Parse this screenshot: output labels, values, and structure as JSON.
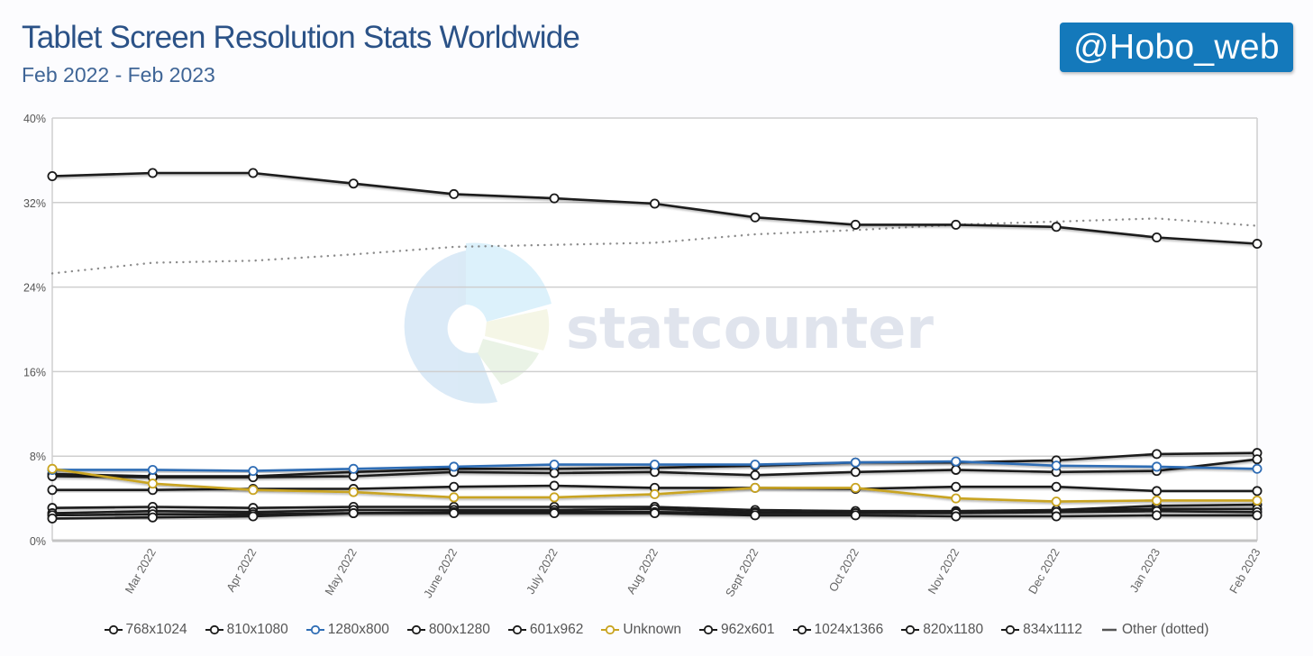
{
  "header": {
    "title": "Tablet Screen Resolution Stats Worldwide",
    "subtitle": "Feb 2022 - Feb 2023",
    "badge": "@Hobo_web"
  },
  "watermark": {
    "text": "statcounter"
  },
  "colors": {
    "black_series": "#1a1a1a",
    "blue_series": "#2f6db5",
    "unknown_series": "#c9a420",
    "other_series": "#888888",
    "badge_bg": "#1479bb",
    "title": "#2b5287"
  },
  "chart_data": {
    "type": "line",
    "title": "Tablet Screen Resolution Stats Worldwide",
    "subtitle": "Feb 2022 - Feb 2023",
    "xlabel": "",
    "ylabel": "",
    "ylim": [
      0,
      40
    ],
    "yticks": [
      0,
      8,
      16,
      24,
      32,
      40
    ],
    "ytick_labels": [
      "0%",
      "8%",
      "16%",
      "24%",
      "32%",
      "40%"
    ],
    "grid": true,
    "legend_position": "bottom",
    "x": [
      "Feb 2022",
      "Mar 2022",
      "Apr 2022",
      "May 2022",
      "June 2022",
      "July 2022",
      "Aug 2022",
      "Sept 2022",
      "Oct 2022",
      "Nov 2022",
      "Dec 2022",
      "Jan 2023",
      "Feb 2023"
    ],
    "xtick_labels": [
      "Mar 2022",
      "Apr 2022",
      "May 2022",
      "June 2022",
      "July 2022",
      "Aug 2022",
      "Sept 2022",
      "Oct 2022",
      "Nov 2022",
      "Dec 2022",
      "Jan 2023",
      "Feb 2023"
    ],
    "series": [
      {
        "name": "768x1024",
        "color": "#1a1a1a",
        "style": "marker",
        "values": [
          34.5,
          34.8,
          34.8,
          33.8,
          32.8,
          32.4,
          31.9,
          30.6,
          29.9,
          29.9,
          29.7,
          28.7,
          28.1
        ]
      },
      {
        "name": "810x1080",
        "color": "#1a1a1a",
        "style": "marker",
        "values": [
          6.3,
          6.1,
          6.1,
          6.5,
          6.8,
          6.8,
          6.9,
          7.1,
          7.4,
          7.4,
          7.6,
          8.2,
          8.3
        ]
      },
      {
        "name": "1280x800",
        "color": "#2f6db5",
        "style": "marker",
        "values": [
          6.7,
          6.7,
          6.6,
          6.8,
          7.0,
          7.2,
          7.2,
          7.2,
          7.4,
          7.5,
          7.1,
          7.0,
          6.8
        ]
      },
      {
        "name": "800x1280",
        "color": "#1a1a1a",
        "style": "marker",
        "values": [
          6.1,
          6.0,
          6.0,
          6.1,
          6.5,
          6.4,
          6.5,
          6.2,
          6.5,
          6.7,
          6.5,
          6.6,
          7.7
        ]
      },
      {
        "name": "601x962",
        "color": "#1a1a1a",
        "style": "marker",
        "values": [
          4.8,
          4.8,
          4.9,
          4.9,
          5.1,
          5.2,
          5.0,
          5.0,
          4.9,
          5.1,
          5.1,
          4.7,
          4.7
        ]
      },
      {
        "name": "Unknown",
        "color": "#c9a420",
        "style": "marker",
        "values": [
          6.8,
          5.4,
          4.8,
          4.6,
          4.1,
          4.1,
          4.4,
          5.0,
          5.0,
          4.0,
          3.7,
          3.8,
          3.8
        ]
      },
      {
        "name": "962x601",
        "color": "#1a1a1a",
        "style": "marker",
        "values": [
          3.1,
          3.2,
          3.1,
          3.2,
          3.2,
          3.2,
          3.2,
          2.9,
          2.8,
          2.8,
          2.9,
          3.3,
          3.4
        ]
      },
      {
        "name": "1024x1366",
        "color": "#1a1a1a",
        "style": "marker",
        "values": [
          2.6,
          2.8,
          2.7,
          2.9,
          2.9,
          2.9,
          3.0,
          2.7,
          2.6,
          2.7,
          2.9,
          3.0,
          3.0
        ]
      },
      {
        "name": "820x1180",
        "color": "#1a1a1a",
        "style": "marker",
        "values": [
          2.4,
          2.5,
          2.5,
          2.6,
          2.7,
          2.7,
          2.7,
          2.6,
          2.6,
          2.6,
          2.7,
          2.8,
          2.7
        ]
      },
      {
        "name": "834x1112",
        "color": "#1a1a1a",
        "style": "marker",
        "values": [
          2.1,
          2.2,
          2.3,
          2.6,
          2.6,
          2.6,
          2.6,
          2.4,
          2.4,
          2.3,
          2.3,
          2.4,
          2.4
        ]
      },
      {
        "name": "Other (dotted)",
        "color": "#888888",
        "style": "dotted",
        "values": [
          25.3,
          26.3,
          26.5,
          27.1,
          27.8,
          28.0,
          28.2,
          29.0,
          29.4,
          29.9,
          30.2,
          30.5,
          29.8
        ]
      }
    ]
  }
}
